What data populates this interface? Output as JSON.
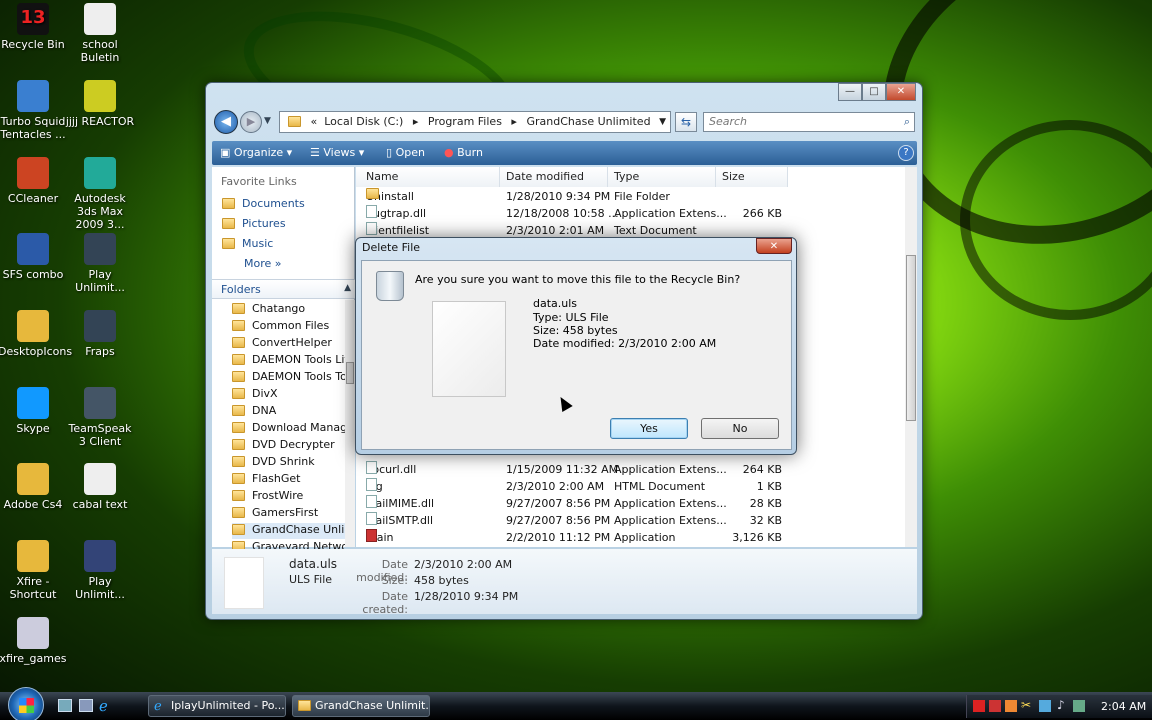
{
  "desktop": {
    "icons": [
      {
        "label": "Recycle Bin"
      },
      {
        "label": "school Buletin"
      },
      {
        "label": "Turbo Squid Tentacles ..."
      },
      {
        "label": "jjjj REACTOR"
      },
      {
        "label": "CCleaner"
      },
      {
        "label": "Autodesk 3ds Max 2009 3..."
      },
      {
        "label": "SFS combo"
      },
      {
        "label": "Play Unlimit..."
      },
      {
        "label": "DesktopIcons"
      },
      {
        "label": "Fraps"
      },
      {
        "label": "Skype"
      },
      {
        "label": "TeamSpeak 3 Client"
      },
      {
        "label": "Adobe Cs4"
      },
      {
        "label": "cabal text"
      },
      {
        "label": "Xfire - Shortcut"
      },
      {
        "label": "Play Unlimit..."
      },
      {
        "label": "xfire_games"
      }
    ],
    "recycle_badge": "13"
  },
  "explorer": {
    "window_buttons": {
      "minimize": "—",
      "maximize": "□",
      "close": "✕"
    },
    "address": {
      "chevron": "«",
      "parts": [
        "Local Disk (C:)",
        "Program Files",
        "GrandChase Unlimited"
      ],
      "sep": "▸"
    },
    "search_placeholder": "Search",
    "toolbar": {
      "organize": "Organize",
      "views": "Views",
      "open": "Open",
      "burn": "Burn",
      "help": "?"
    },
    "nav": {
      "favorite_heading": "Favorite Links",
      "favorites": [
        "Documents",
        "Pictures",
        "Music"
      ],
      "more": "More",
      "folders_heading": "Folders",
      "folders": [
        "Chatango",
        "Common Files",
        "ConvertHelper",
        "DAEMON Tools Lit",
        "DAEMON Tools To",
        "DivX",
        "DNA",
        "Download Manage",
        "DVD Decrypter",
        "DVD Shrink",
        "FlashGet",
        "FrostWire",
        "GamersFirst",
        "GrandChase Unlim",
        "Graveyard Network"
      ]
    },
    "columns": [
      "Name",
      "Date modified",
      "Type",
      "Size"
    ],
    "rows": [
      {
        "name": "Uninstall",
        "date": "1/28/2010 9:34 PM",
        "type": "File Folder",
        "size": ""
      },
      {
        "name": "bugtrap.dll",
        "date": "12/18/2008 10:58 ...",
        "type": "Application Extens...",
        "size": "266 KB"
      },
      {
        "name": "clientfilelist",
        "date": "2/3/2010 2:01 AM",
        "type": "Text Document",
        "size": ""
      }
    ],
    "rows_lower": [
      {
        "name": "libcurl.dll",
        "date": "1/15/2009 11:32 AM",
        "type": "Application Extens...",
        "size": "264 KB"
      },
      {
        "name": "log",
        "date": "2/3/2010 2:00 AM",
        "type": "HTML Document",
        "size": "1 KB"
      },
      {
        "name": "MailMIME.dll",
        "date": "9/27/2007 8:56 PM",
        "type": "Application Extens...",
        "size": "28 KB"
      },
      {
        "name": "MailSMTP.dll",
        "date": "9/27/2007 8:56 PM",
        "type": "Application Extens...",
        "size": "32 KB"
      },
      {
        "name": "main",
        "date": "2/2/2010 11:12 PM",
        "type": "Application",
        "size": "3,126 KB"
      }
    ],
    "details": {
      "name": "data.uls",
      "type": "ULS File",
      "date_modified_label": "Date modified:",
      "date_modified": "2/3/2010 2:00 AM",
      "size_label": "Size:",
      "size": "458 bytes",
      "date_created_label": "Date created:",
      "date_created": "1/28/2010 9:34 PM"
    }
  },
  "dialog": {
    "title": "Delete File",
    "close": "✕",
    "question": "Are you sure you want to move this file to the Recycle Bin?",
    "file_name": "data.uls",
    "file_type": "Type: ULS File",
    "file_size": "Size: 458 bytes",
    "file_date": "Date modified: 2/3/2010 2:00 AM",
    "yes": "Yes",
    "no": "No"
  },
  "taskbar": {
    "tasks": [
      "IplayUnlimited - Po...",
      "GrandChase Unlimit..."
    ],
    "clock": "2:04 AM"
  }
}
